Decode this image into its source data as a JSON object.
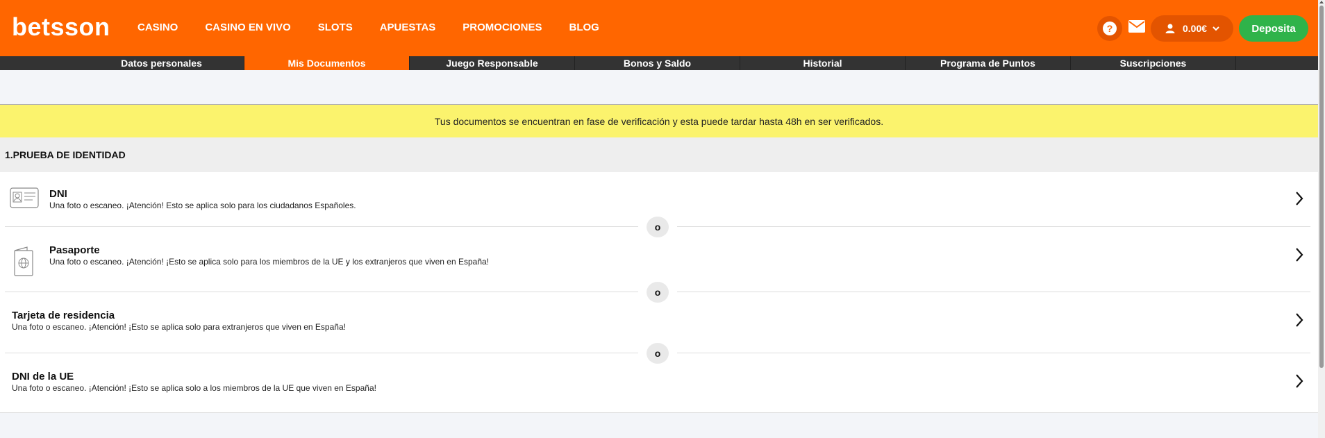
{
  "header": {
    "logo": "betsson",
    "nav": [
      "CASINO",
      "CASINO EN VIVO",
      "SLOTS",
      "APUESTAS",
      "PROMOCIONES",
      "BLOG"
    ],
    "help_label": "?",
    "balance": "0.00€",
    "deposit_label": "Deposita"
  },
  "subnav": {
    "items": [
      "Datos personales",
      "Mis Documentos",
      "Juego Responsable",
      "Bonos y Saldo",
      "Historial",
      "Programa de Puntos",
      "Suscripciones"
    ],
    "active": "Mis Documentos"
  },
  "notice": "Tus documentos se encuentran en fase de verificación y esta puede tardar hasta 48h en ser verificados.",
  "section_title": "1.PRUEBA DE IDENTIDAD",
  "documents": [
    {
      "title": "DNI",
      "description": "Una foto o escaneo. ¡Atención! Esto se aplica solo para los ciudadanos Españoles.",
      "icon": "id-card-icon"
    },
    {
      "title": "Pasaporte",
      "description": "Una foto o escaneo. ¡Atención! ¡Esto se aplica solo para los miembros de la UE y los extranjeros que viven en España!",
      "icon": "passport-icon"
    },
    {
      "title": "Tarjeta de residencia",
      "description": "Una foto o escaneo. ¡Atención! ¡Esto se aplica solo para extranjeros que viven en España!"
    },
    {
      "title": "DNI de la UE",
      "description": "Una foto o escaneo. ¡Atención! ¡Esto se aplica solo a los miembros de la UE que viven en España!"
    }
  ],
  "or_label": "o",
  "colors": {
    "brand": "#ff6600",
    "deposit": "#2fb34a",
    "notice": "#fbf36d"
  }
}
